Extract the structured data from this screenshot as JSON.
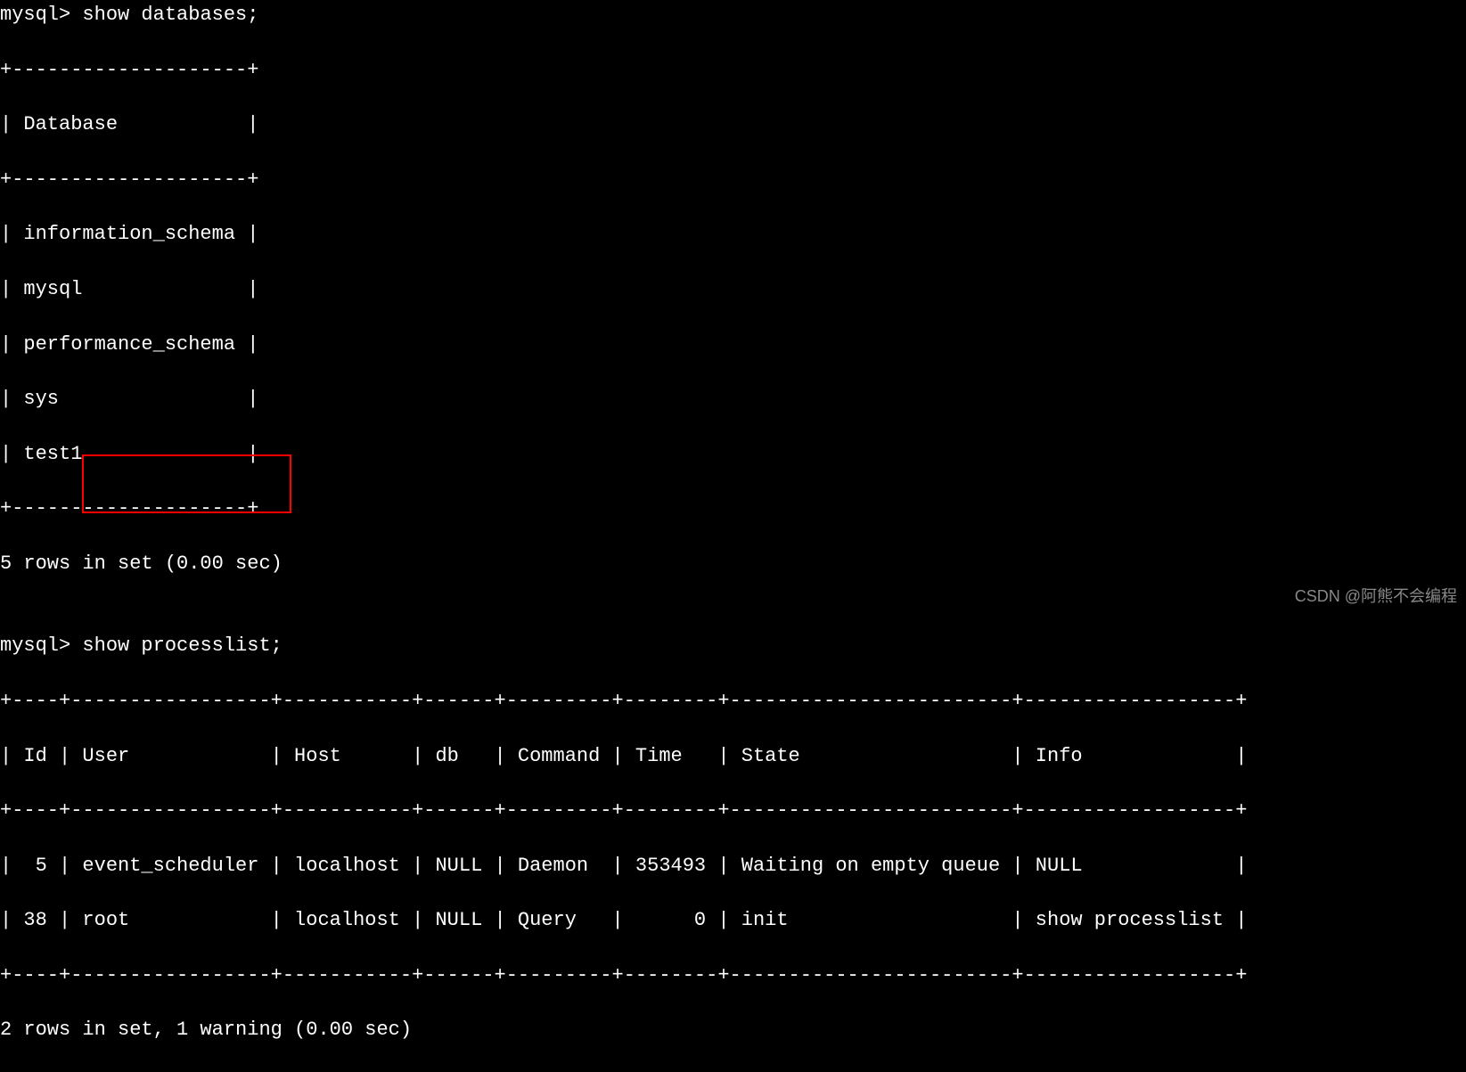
{
  "prompt": "mysql> ",
  "command1": "show databases;",
  "databases_table": {
    "border_top": "+--------------------+",
    "header_row": "| Database           |",
    "border_mid": "+--------------------+",
    "rows": [
      "| information_schema |",
      "| mysql              |",
      "| performance_schema |",
      "| sys                |",
      "| test1              |"
    ],
    "border_bottom": "+--------------------+"
  },
  "databases_summary": "5 rows in set (0.00 sec)",
  "blank": "",
  "command2": "show processlist;",
  "process_table": {
    "border_top": "+----+-----------------+-----------+------+---------+--------+------------------------+------------------+",
    "header_row": "| Id | User            | Host      | db   | Command | Time   | State                  | Info             |",
    "border_mid": "+----+-----------------+-----------+------+---------+--------+------------------------+------------------+",
    "rows": [
      "|  5 | event_scheduler | localhost | NULL | Daemon  | 353493 | Waiting on empty queue | NULL             |",
      "| 38 | root            | localhost | NULL | Query   |      0 | init                   | show processlist |"
    ],
    "border_bottom": "+----+-----------------+-----------+------+---------+--------+------------------------+------------------+"
  },
  "process_summary": "2 rows in set, 1 warning (0.00 sec)",
  "chart_data": {
    "type": "table",
    "tables": [
      {
        "name": "databases",
        "columns": [
          "Database"
        ],
        "rows": [
          [
            "information_schema"
          ],
          [
            "mysql"
          ],
          [
            "performance_schema"
          ],
          [
            "sys"
          ],
          [
            "test1"
          ]
        ],
        "summary": "5 rows in set (0.00 sec)"
      },
      {
        "name": "processlist",
        "columns": [
          "Id",
          "User",
          "Host",
          "db",
          "Command",
          "Time",
          "State",
          "Info"
        ],
        "rows": [
          [
            5,
            "event_scheduler",
            "localhost",
            "NULL",
            "Daemon",
            353493,
            "Waiting on empty queue",
            "NULL"
          ],
          [
            38,
            "root",
            "localhost",
            "NULL",
            "Query",
            0,
            "init",
            "show processlist"
          ]
        ],
        "summary": "2 rows in set, 1 warning (0.00 sec)"
      }
    ]
  },
  "highlight_users": [
    "event_scheduler",
    "root"
  ],
  "watermark": "CSDN @阿熊不会编程"
}
